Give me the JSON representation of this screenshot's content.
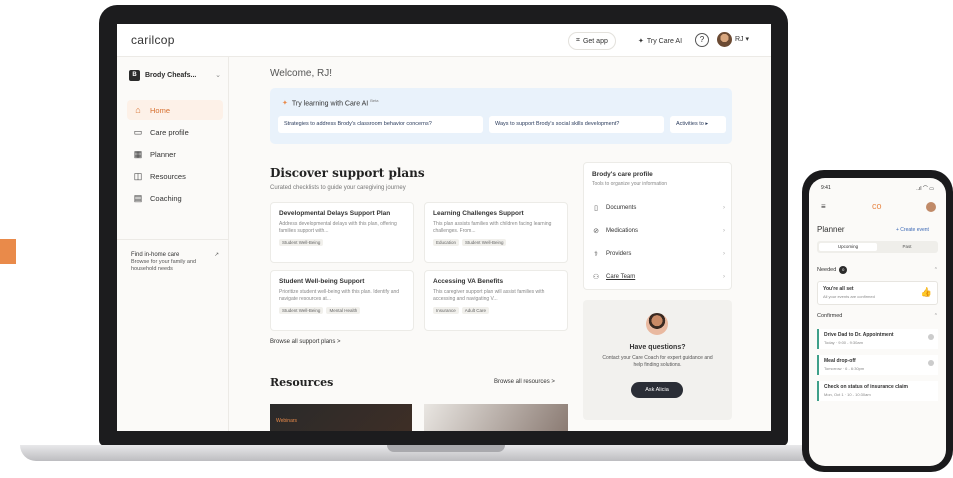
{
  "app": {
    "logo": "carilcop",
    "get_app": "Get app",
    "try_care_ai": "Try Care AI",
    "help": "?",
    "user_initials": "RJ"
  },
  "sidebar": {
    "profile": "Brody Cheafs...",
    "profile_initial": "B",
    "items": [
      {
        "label": "Home",
        "icon": "home-icon"
      },
      {
        "label": "Care profile",
        "icon": "folder-icon"
      },
      {
        "label": "Planner",
        "icon": "calendar-icon"
      },
      {
        "label": "Resources",
        "icon": "book-icon"
      },
      {
        "label": "Coaching",
        "icon": "chat-icon"
      }
    ],
    "find_care_title": "Find in-home care",
    "find_care_desc": "Browse for your family and household needs"
  },
  "main": {
    "welcome": "Welcome, RJ!",
    "ai": {
      "title": "Try learning with Care AI",
      "badge": "Beta",
      "chips": [
        "Strategies to address Brody's classroom behavior concerns?",
        "Ways to support Brody's social skills development?",
        "Activities to"
      ]
    },
    "discover": {
      "title": "Discover support plans",
      "subtitle": "Curated checklists to guide your caregiving journey",
      "plans": [
        {
          "title": "Developmental Delays Support Plan",
          "desc": "Address developmental delays with this plan, offering families support with...",
          "tags": [
            "Student Well-Being"
          ]
        },
        {
          "title": "Learning Challenges Support",
          "desc": "This plan assists families with children facing learning challenges. From...",
          "tags": [
            "Education",
            "Student Well-Being"
          ]
        },
        {
          "title": "Student Well-being Support",
          "desc": "Prioritize student well-being with this plan. Identify and navigate resources at...",
          "tags": [
            "Student Well-Being",
            "Mental Health"
          ]
        },
        {
          "title": "Accessing VA Benefits",
          "desc": "This caregiver support plan will assist families with accessing and navigating V...",
          "tags": [
            "Insurance",
            "Adult Care"
          ]
        }
      ],
      "browse": "Browse all support plans >"
    },
    "resources": {
      "title": "Resources",
      "browse": "Browse all resources >",
      "card1_label": "Webinars"
    }
  },
  "care_profile": {
    "title": "Brody's care profile",
    "subtitle": "Tools to organize your information",
    "rows": [
      {
        "label": "Documents",
        "icon": "document-icon"
      },
      {
        "label": "Medications",
        "icon": "pill-icon"
      },
      {
        "label": "Providers",
        "icon": "provider-icon"
      },
      {
        "label": "Care Team",
        "icon": "team-icon"
      }
    ]
  },
  "questions": {
    "title": "Have questions?",
    "desc": "Contact your Care Coach for expert guidance and help finding solutions.",
    "button": "Ask Alicia"
  },
  "phone": {
    "time": "9:41",
    "signal": "..ıl ⌒ ▭",
    "logo": "co",
    "planner": "Planner",
    "create": "+ Create event",
    "tab_upcoming": "Upcoming",
    "tab_past": "Past",
    "needed": "Needed",
    "needed_count": "0",
    "allset_title": "You're all set",
    "allset_desc": "All your events are confirmed",
    "confirmed": "Confirmed",
    "events": [
      {
        "title": "Drive Dad to Dr. Appointment",
        "time": "Today · 9:00 - 9:30am"
      },
      {
        "title": "Meal drop-off",
        "time": "Tomorrow · 6 - 6:30pm"
      },
      {
        "title": "Check on status of insurance claim",
        "time": "Mon, Oct 1 · 10 - 10:30am"
      }
    ]
  },
  "colors": {
    "accent": "#e98a4a",
    "ai_bg": "#e9f2fb",
    "dark_button": "#2b2e36"
  }
}
